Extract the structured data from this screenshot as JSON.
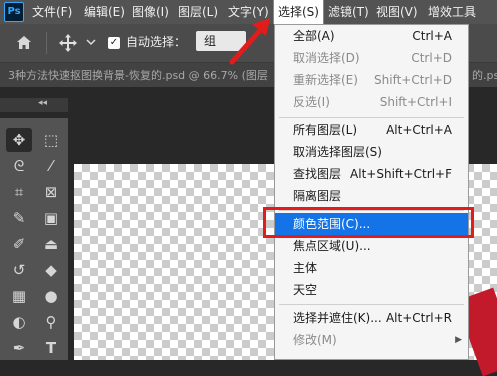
{
  "app": {
    "logo": "Ps",
    "accent": "#31a8ff"
  },
  "menubar": {
    "items": [
      {
        "label": "文件(F)"
      },
      {
        "label": "编辑(E)"
      },
      {
        "label": "图像(I)"
      },
      {
        "label": "图层(L)"
      },
      {
        "label": "文字(Y)"
      },
      {
        "label": "选择(S)"
      },
      {
        "label": "滤镜(T)"
      },
      {
        "label": "视图(V)"
      },
      {
        "label": "增效工具"
      }
    ]
  },
  "options_bar": {
    "auto_select_label": "自动选择：",
    "auto_select_checked": true,
    "group_value": "组",
    "icons": [
      "home-icon",
      "move-icon",
      "chevron-down-icon"
    ]
  },
  "document": {
    "tab_title": "3种方法快速抠图换背景-恢复的.psd @ 66.7% (图层",
    "tab_right": "的.ps"
  },
  "select_menu": {
    "items": [
      {
        "label": "全部(A)",
        "shortcut": "Ctrl+A",
        "disabled": false
      },
      {
        "label": "取消选择(D)",
        "shortcut": "Ctrl+D",
        "disabled": true
      },
      {
        "label": "重新选择(E)",
        "shortcut": "Shift+Ctrl+D",
        "disabled": true
      },
      {
        "label": "反选(I)",
        "shortcut": "Shift+Ctrl+I",
        "disabled": true
      },
      {
        "label": "所有图层(L)",
        "shortcut": "Alt+Ctrl+A",
        "disabled": false
      },
      {
        "label": "取消选择图层(S)",
        "shortcut": "",
        "disabled": false
      },
      {
        "label": "查找图层",
        "shortcut": "Alt+Shift+Ctrl+F",
        "disabled": false
      },
      {
        "label": "隔离图层",
        "shortcut": "",
        "disabled": false
      },
      {
        "label": "颜色范围(C)...",
        "shortcut": "",
        "disabled": false,
        "highlighted": true
      },
      {
        "label": "焦点区域(U)...",
        "shortcut": "",
        "disabled": false
      },
      {
        "label": "主体",
        "shortcut": "",
        "disabled": false
      },
      {
        "label": "天空",
        "shortcut": "",
        "disabled": false
      },
      {
        "label": "选择并遮住(K)...",
        "shortcut": "Alt+Ctrl+R",
        "disabled": false
      },
      {
        "label": "修改(M)",
        "shortcut": "",
        "disabled": true,
        "submenu": true
      }
    ]
  },
  "toolbar": {
    "tools": [
      "move-tool-icon",
      "marquee-tool-icon",
      "lasso-tool-icon",
      "magic-wand-tool-icon",
      "crop-tool-icon",
      "frame-tool-icon",
      "eyedropper-tool-icon",
      "healing-brush-tool-icon",
      "brush-tool-icon",
      "stamp-tool-icon",
      "history-brush-tool-icon",
      "eraser-tool-icon",
      "gradient-tool-icon",
      "blur-tool-icon",
      "dodge-tool-icon",
      "pen-tool-icon",
      "type-tool-icon"
    ]
  },
  "annotations": {
    "color": "#e21b1b"
  }
}
